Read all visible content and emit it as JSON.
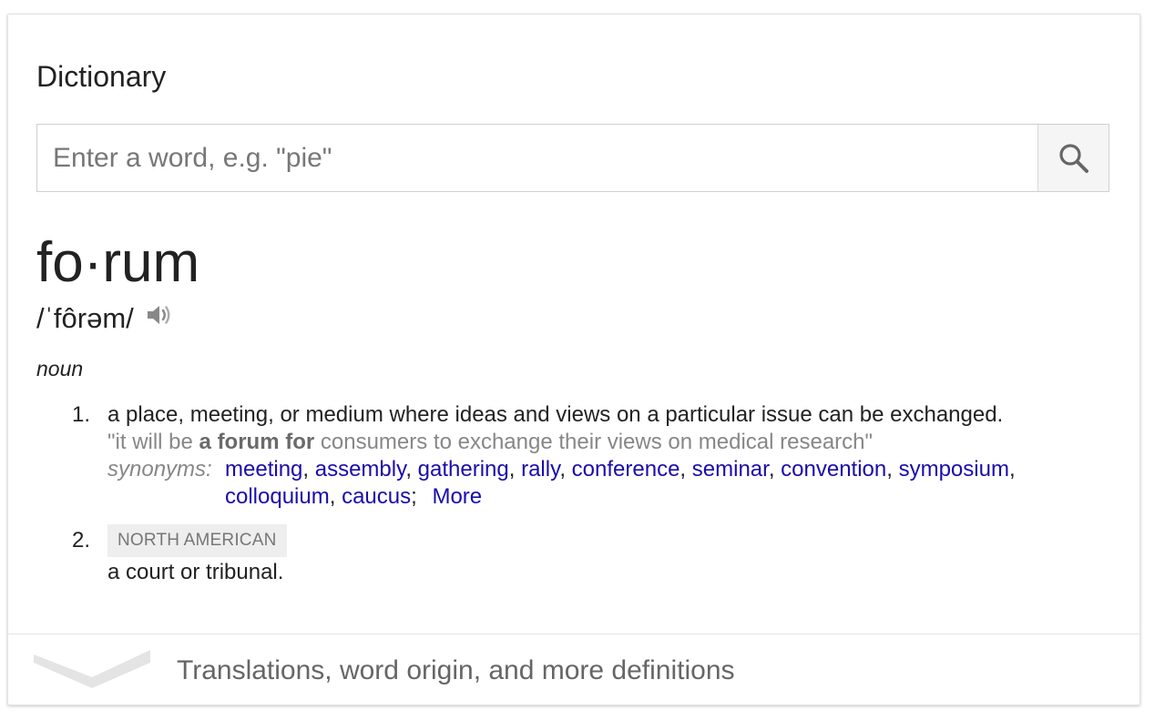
{
  "card": {
    "title": "Dictionary",
    "search": {
      "placeholder": "Enter a word, e.g. \"pie\"",
      "icon": "search-icon"
    },
    "headword": "fo·rum",
    "pronunciation": "/ˈfôrəm/",
    "part_of_speech": "noun",
    "definitions": [
      {
        "number": "1.",
        "text": "a place, meeting, or medium where ideas and views on a particular issue can be exchanged.",
        "example": {
          "open": "\"it will be ",
          "bold": "a forum for",
          "rest": " consumers to exchange their views on medical research\""
        },
        "synonyms_label": "synonyms:",
        "synonyms": [
          "meeting",
          "assembly",
          "gathering",
          "rally",
          "conference",
          "seminar",
          "convention",
          "symposium",
          "colloquium",
          "caucus"
        ],
        "more_label": "More"
      },
      {
        "number": "2.",
        "label": "NORTH AMERICAN",
        "text": "a court or tribunal."
      }
    ],
    "footer": {
      "text": "Translations, word origin, and more definitions",
      "icon": "chevron-down-icon"
    }
  },
  "colors": {
    "link": "#1a0dab",
    "muted": "#878787",
    "badge_bg": "#eeeeee"
  }
}
